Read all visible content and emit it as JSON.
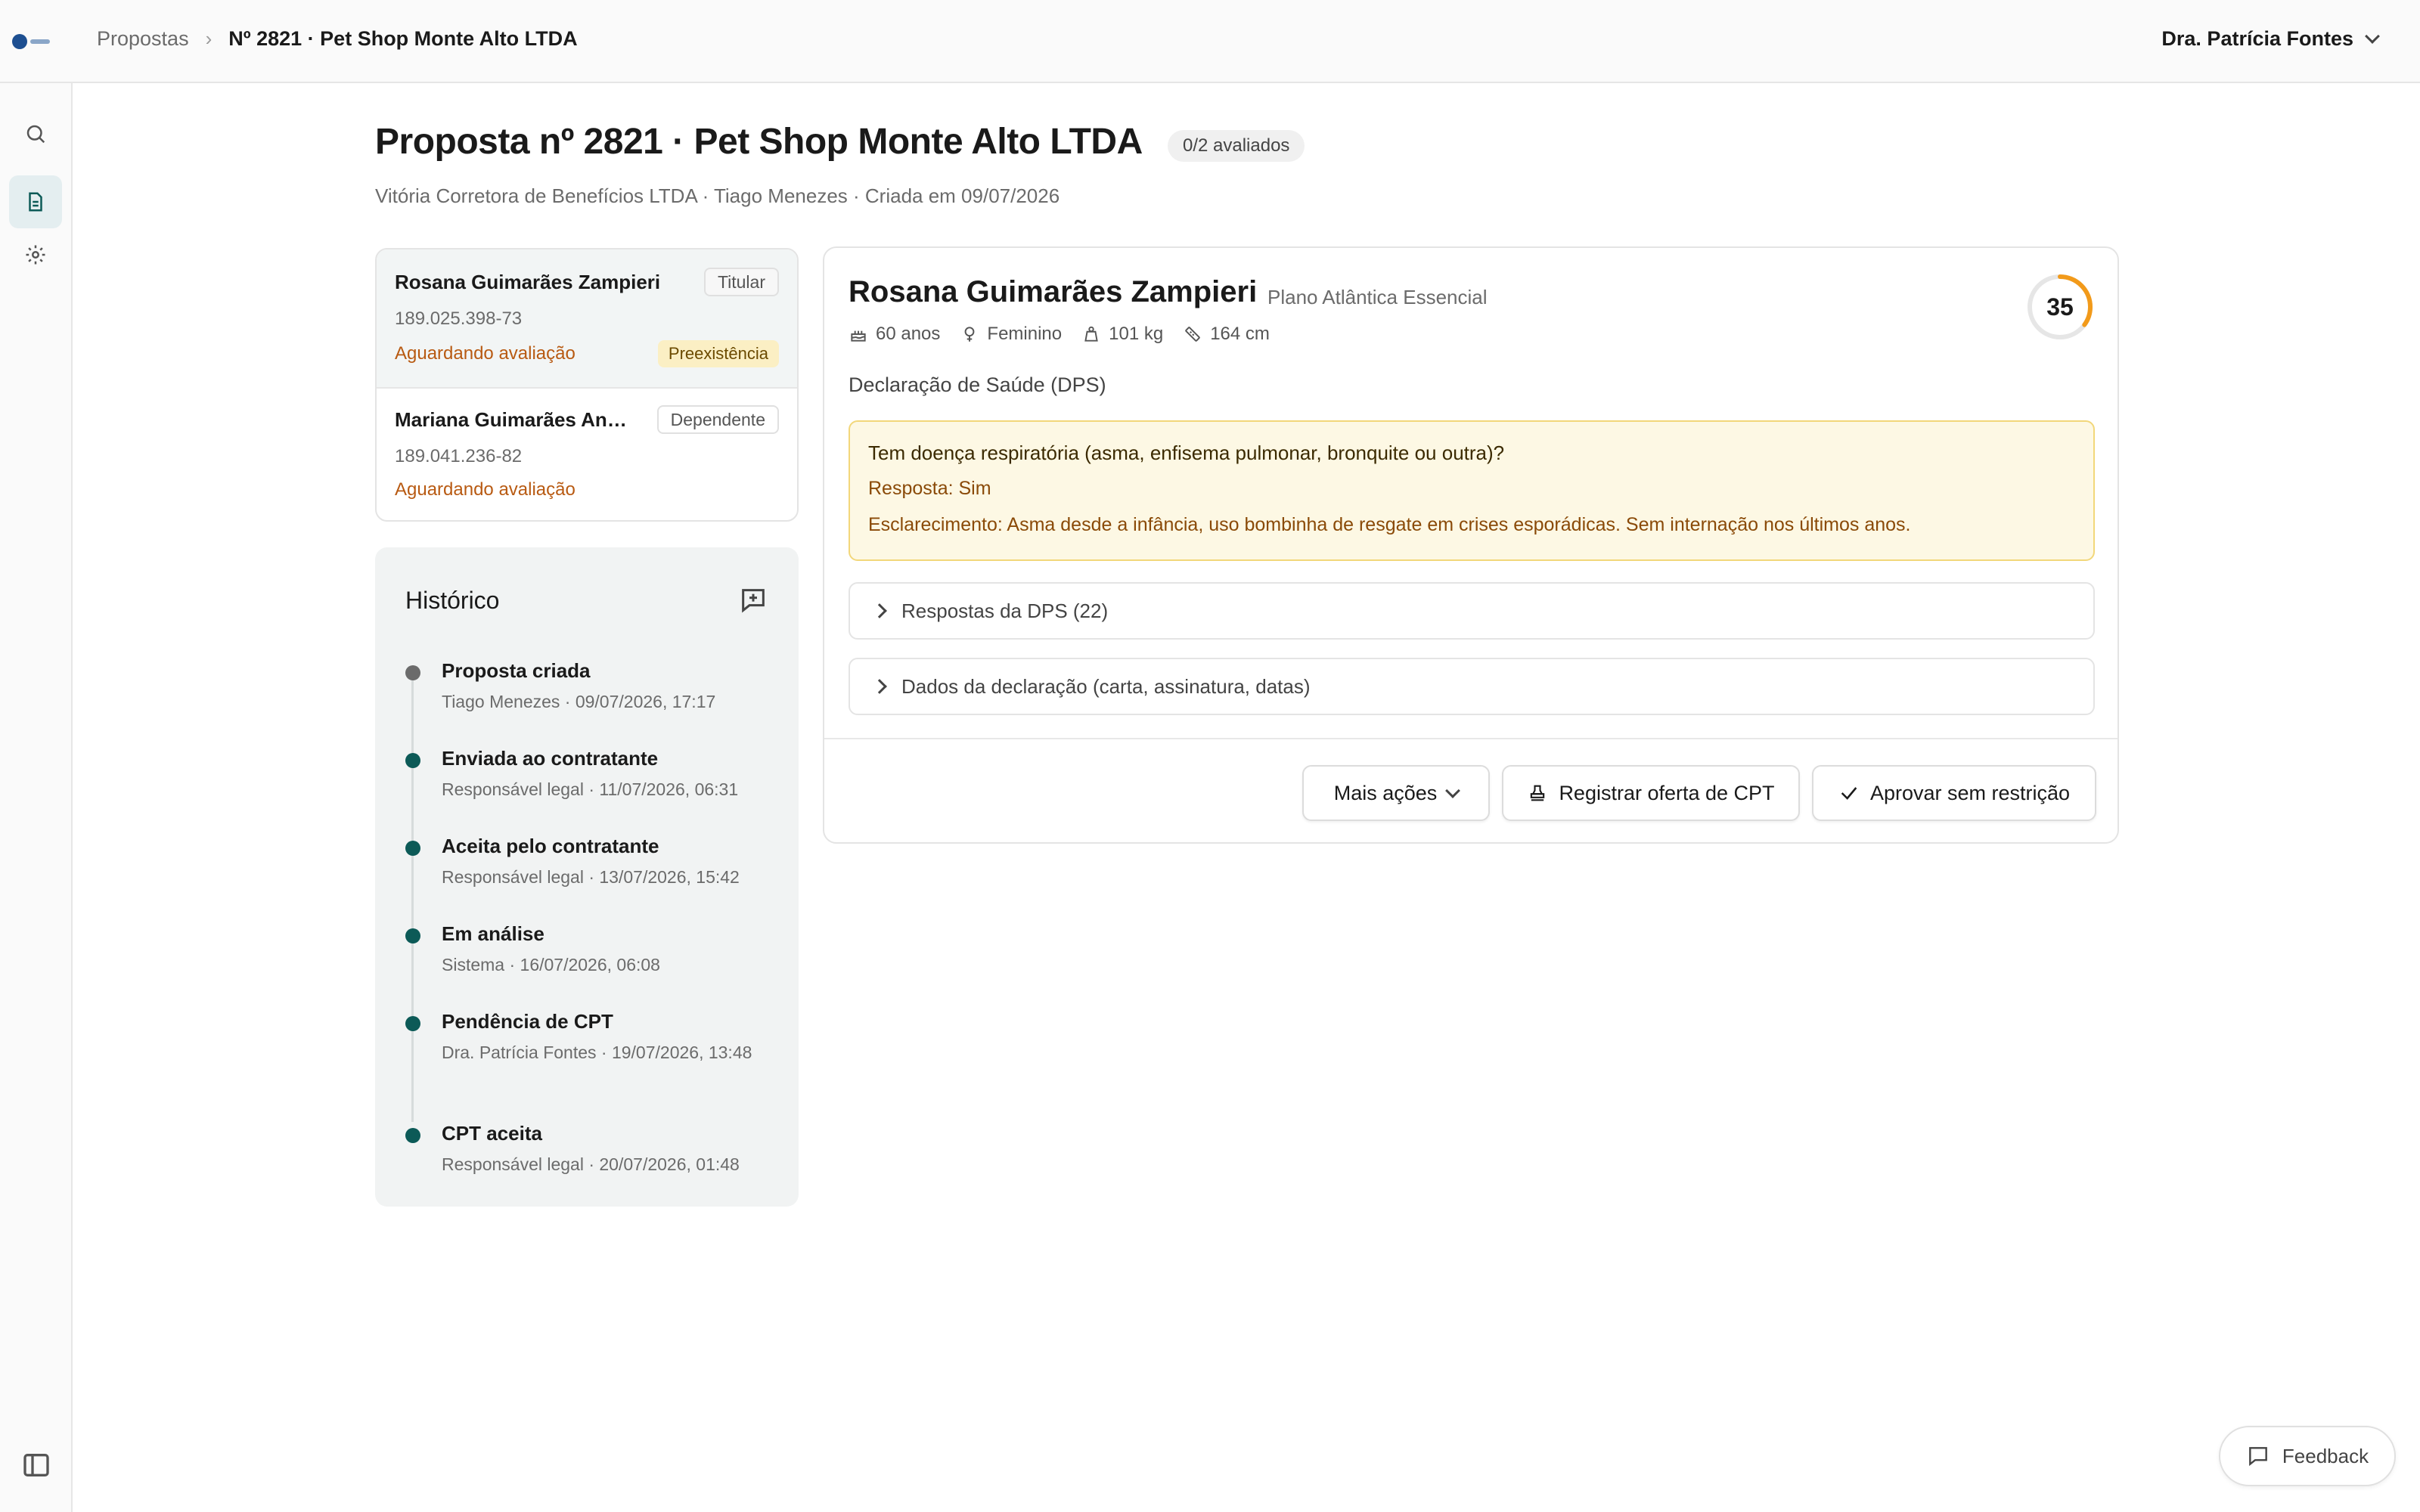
{
  "breadcrumb": {
    "root": "Propostas",
    "current": "Nº 2821 · Pet Shop Monte Alto LTDA"
  },
  "user": {
    "name": "Dra. Patrícia Fontes"
  },
  "page": {
    "title": "Proposta nº 2821 · Pet Shop Monte Alto LTDA",
    "eval_badge": "0/2 avaliados",
    "subtitle": "Vitória Corretora de Benefícios LTDA · Tiago Menezes · Criada em 09/07/2026"
  },
  "beneficiaries": [
    {
      "name": "Rosana Guimarães Zampieri",
      "role": "Titular",
      "cpf": "189.025.398-73",
      "status": "Aguardando avaliação",
      "flag": "Preexistência"
    },
    {
      "name": "Mariana Guimarães Andrade",
      "role": "Dependente",
      "cpf": "189.041.236-82",
      "status": "Aguardando avaliação"
    }
  ],
  "history": {
    "title": "Histórico",
    "items": [
      {
        "title": "Proposta criada",
        "meta": "Tiago Menezes · 09/07/2026, 17:17"
      },
      {
        "title": "Enviada ao contratante",
        "meta": "Responsável legal · 11/07/2026, 06:31"
      },
      {
        "title": "Aceita pelo contratante",
        "meta": "Responsável legal · 13/07/2026, 15:42"
      },
      {
        "title": "Em análise",
        "meta": "Sistema · 16/07/2026, 06:08"
      },
      {
        "title": "Pendência de CPT",
        "meta": "Dra. Patrícia Fontes · 19/07/2026, 13:48"
      },
      {
        "title": "CPT aceita",
        "meta": "Responsável legal · 20/07/2026, 01:48"
      }
    ]
  },
  "detail": {
    "name": "Rosana Guimarães Zampieri",
    "plan": "Plano Atlântica Essencial",
    "age": "60 anos",
    "sex": "Feminino",
    "weight": "101 kg",
    "height": "164 cm",
    "score": "35",
    "score_fraction": 0.35,
    "dps_label": "Declaração de Saúde (DPS)",
    "alert": {
      "question": "Tem doença respiratória (asma, enfisema pulmonar, bronquite ou outra)?",
      "answer": "Resposta: Sim",
      "clarification": "Esclarecimento: Asma desde a infância, uso bombinha de resgate em crises esporádicas. Sem internação nos últimos anos."
    },
    "collapse_answers": "Respostas da DPS (22)",
    "collapse_declaration": "Dados da declaração (carta, assinatura, datas)",
    "actions": {
      "more": "Mais ações",
      "cpt": "Registrar oferta de CPT",
      "approve": "Aprovar sem restrição"
    }
  },
  "feedback": {
    "label": "Feedback"
  },
  "colors": {
    "accent": "#0c5a57",
    "warning": "#b85a12",
    "score_ring": "#f29a1a"
  }
}
